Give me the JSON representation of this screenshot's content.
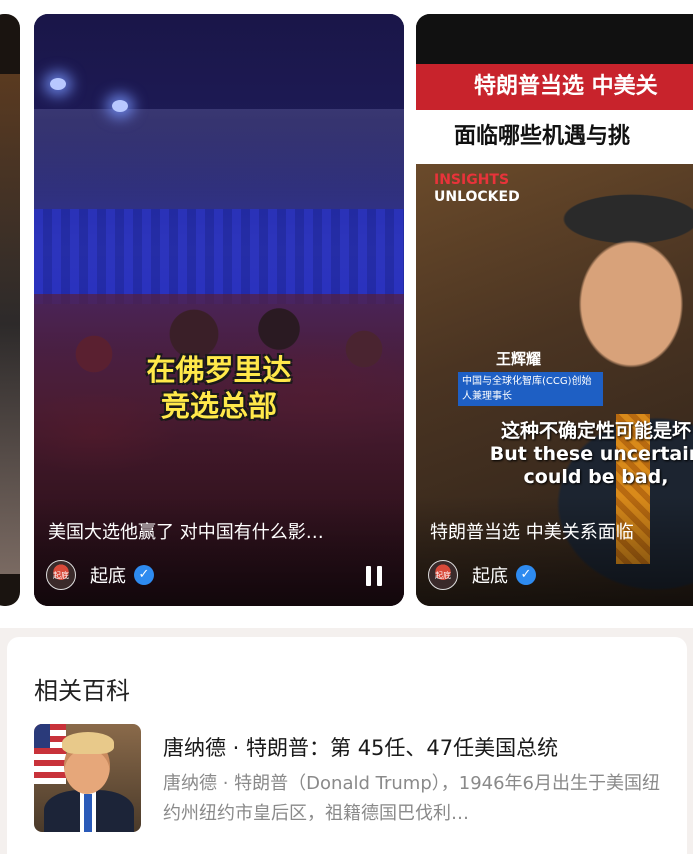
{
  "videos": [
    {
      "overlay_caption_line1": "在佛罗里达",
      "overlay_caption_line2": "竞选总部",
      "description": "美国大选他赢了 对中国有什么影…",
      "author": "起底",
      "author_avatar_text": "起底",
      "verified_icon": "check",
      "playback_state": "playing",
      "pause_icon": "pause-icon"
    },
    {
      "headline_red": "特朗普当选 中美关",
      "headline_white": "面临哪些机遇与挑",
      "brand_line1": "INSIGHTS",
      "brand_line2": "UNLOCKED",
      "speaker_name": "王辉耀",
      "speaker_title": "中国与全球化智库(CCG)创始人兼理事长",
      "subtitle_zh": "这种不确定性可能是坏",
      "subtitle_en_line1": "But these uncertain",
      "subtitle_en_line2": "could be bad,",
      "description": "特朗普当选 中美关系面临",
      "author": "起底",
      "author_avatar_text": "起底",
      "verified_icon": "check"
    }
  ],
  "related": {
    "heading": "相关百科",
    "title": "唐纳德 · 特朗普：第 45任、47任美国总统",
    "description": "唐纳德 · 特朗普（Donald Trump），1946年6月出生于美国纽约州纽约市皇后区，祖籍德国巴伐利…"
  },
  "colors": {
    "accent_red": "#c8232c",
    "caption_yellow": "#ffe94a",
    "verified_blue": "#2e8bf0",
    "muted_text": "#8a8a8a"
  }
}
